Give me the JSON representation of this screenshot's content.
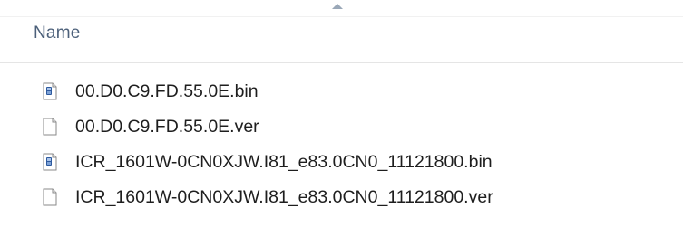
{
  "columns": {
    "name_label": "Name"
  },
  "files": [
    {
      "name": "00.D0.C9.FD.55.0E.bin",
      "icon": "binary-file-icon"
    },
    {
      "name": "00.D0.C9.FD.55.0E.ver",
      "icon": "blank-file-icon"
    },
    {
      "name": "ICR_1601W-0CN0XJW.I81_e83.0CN0_11121800.bin",
      "icon": "binary-file-icon"
    },
    {
      "name": "ICR_1601W-0CN0XJW.I81_e83.0CN0_11121800.ver",
      "icon": "blank-file-icon"
    }
  ]
}
